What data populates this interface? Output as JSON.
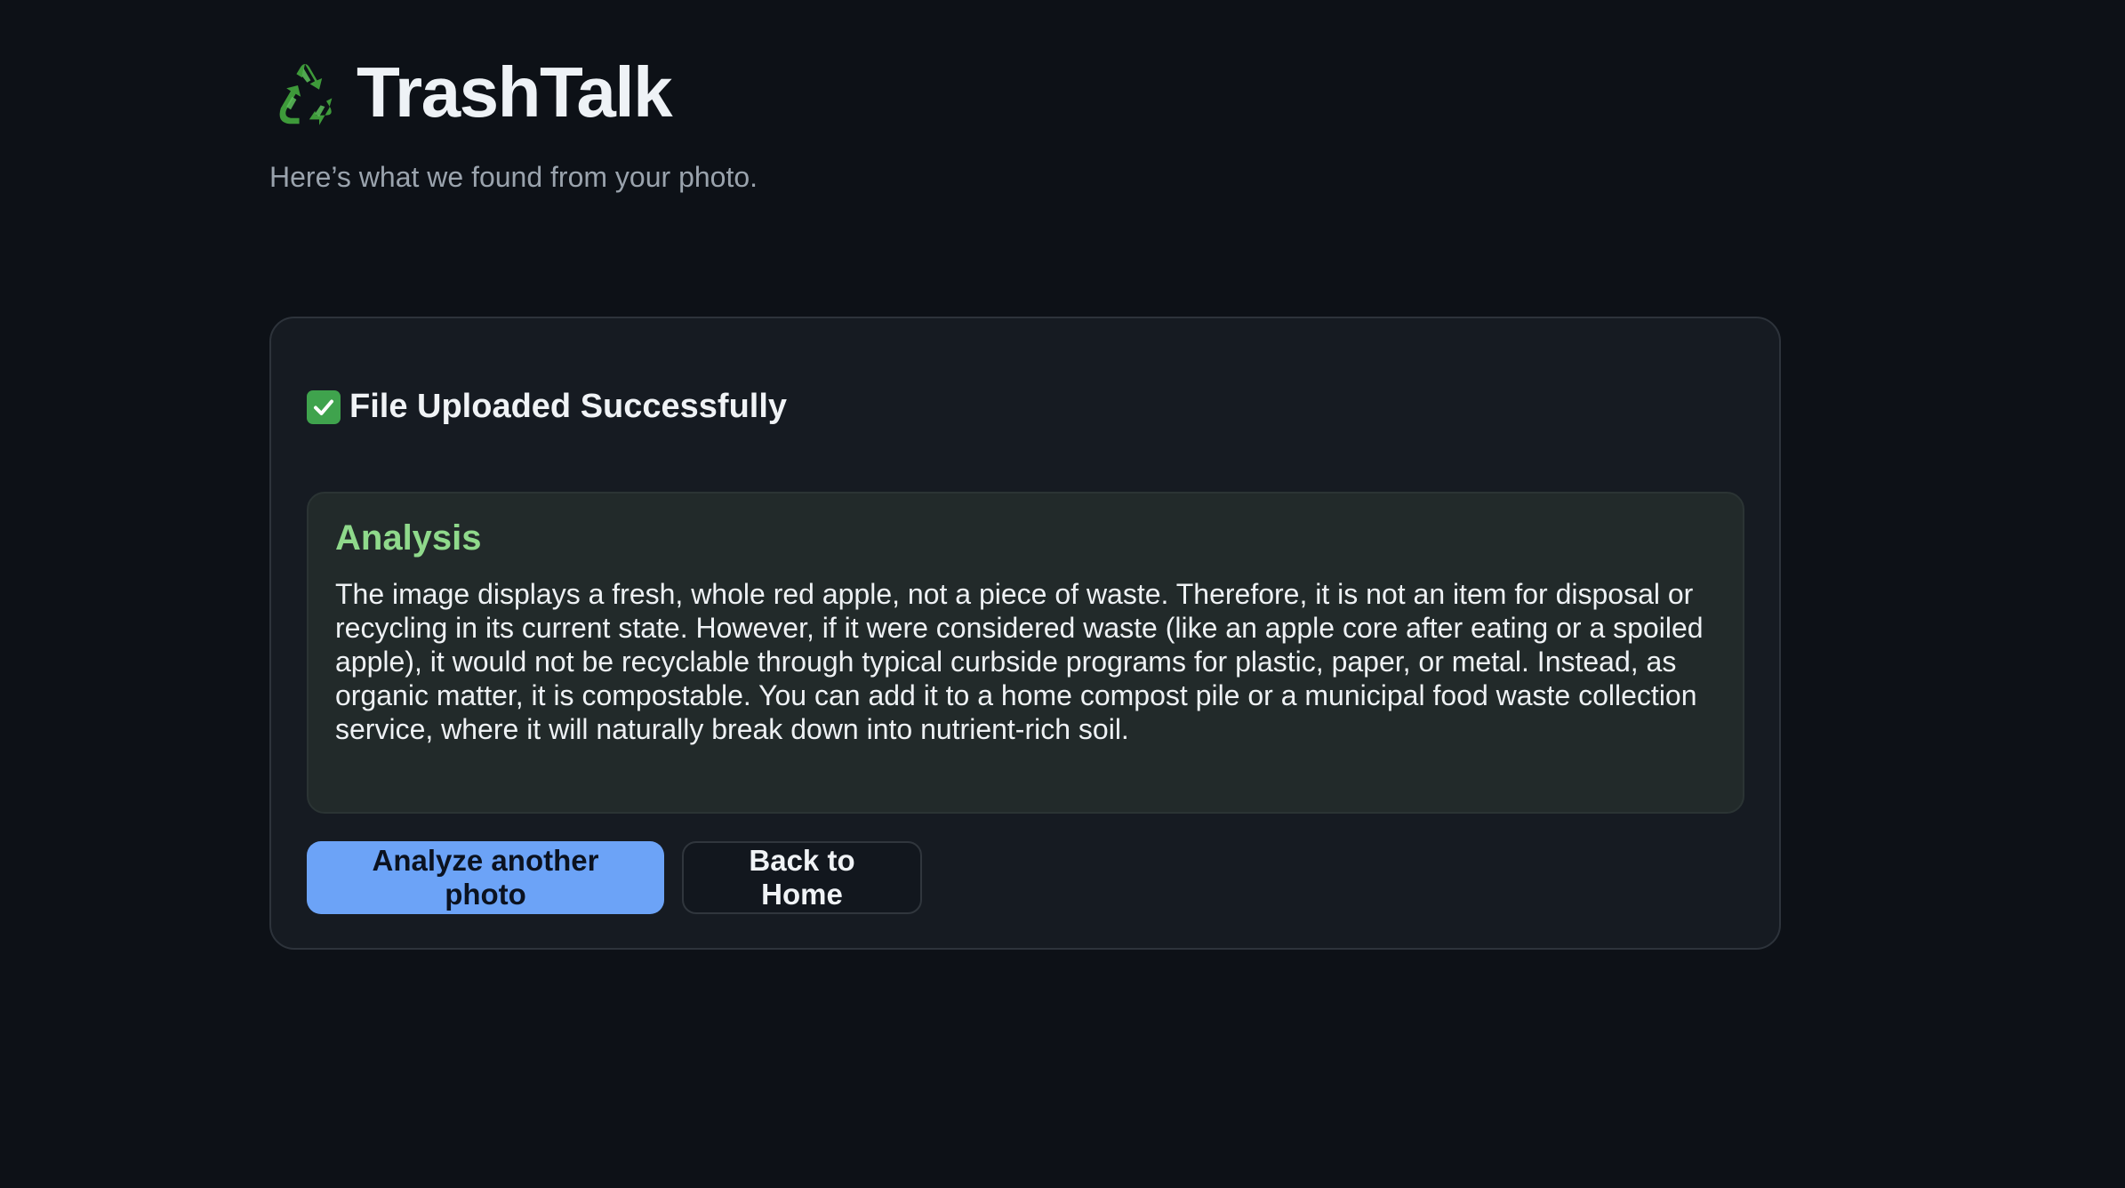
{
  "app": {
    "title": "TrashTalk",
    "subtitle": "Here’s what we found from your photo.",
    "logo_icon": "recycle-icon"
  },
  "result": {
    "status_icon": "check-mark-icon",
    "status_text": "File Uploaded Successfully",
    "analysis_title": "Analysis",
    "analysis_text": "The image displays a fresh, whole red apple, not a piece of waste. Therefore, it is not an item for disposal or recycling in its current state. However, if it were considered waste (like an apple core after eating or a spoiled apple), it would not be recyclable through typical curbside programs for plastic, paper, or metal. Instead, as organic matter, it is compostable. You can add it to a home compost pile or a municipal food waste collection service, where it will naturally break down into nutrient-rich soil."
  },
  "actions": {
    "primary_label": "Analyze another photo",
    "secondary_label": "Back to Home"
  },
  "colors": {
    "background": "#0d1117",
    "card": "#161b22",
    "analysis_panel": "#222a2a",
    "accent_green": "#8fd98b",
    "primary_button": "#6ca3f7",
    "check_green": "#3fa34d"
  }
}
